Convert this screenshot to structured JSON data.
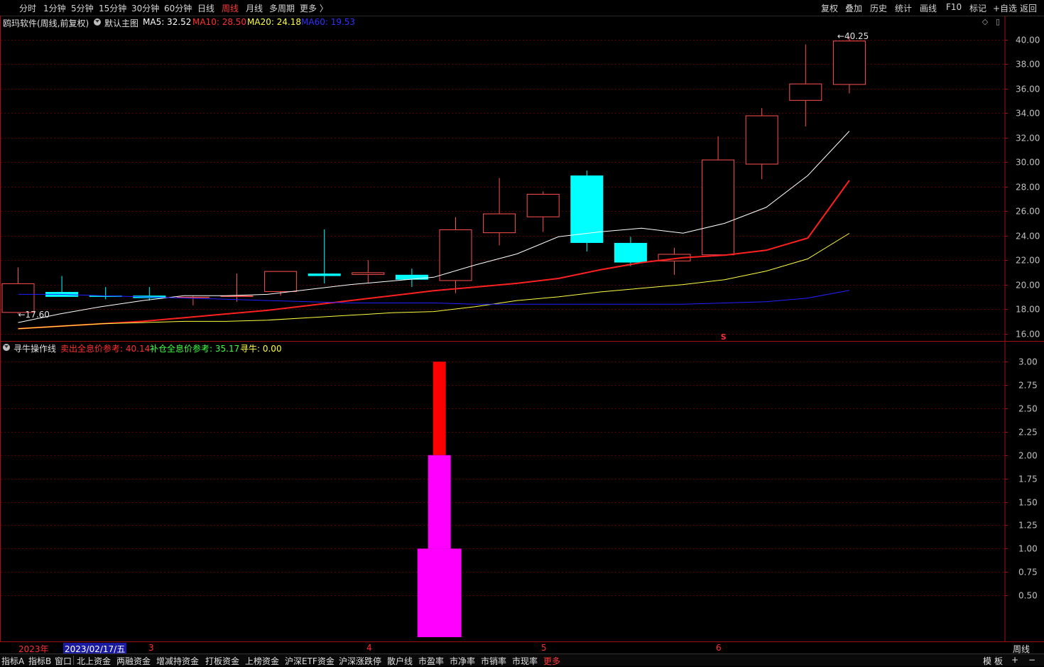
{
  "toolbar": {
    "left_items": [
      "分时",
      "1分钟",
      "5分钟",
      "15分钟",
      "30分钟",
      "60分钟",
      "日线",
      "周线",
      "月线",
      "多周期",
      "更多 〉"
    ],
    "active_item": "周线",
    "right_items": [
      "复权",
      "叠加",
      "历史",
      "统计",
      "画线",
      "F10",
      "标记",
      "+自选",
      "返回"
    ]
  },
  "main_info": {
    "stock_name": "鸥玛软件(周线,前复权)",
    "template": "默认主图",
    "ma5": "MA5: 32.52",
    "ma10": "MA10: 28.50",
    "ma20": "MA20: 24.18",
    "ma60": "MA60: 19.53"
  },
  "sub_info": {
    "indicator": "寻牛操作线",
    "sell_ref": "卖出全息价参考: 40.14",
    "add_ref": "补仓全息价参考: 35.17",
    "xunniu": "寻牛: 0.00"
  },
  "colors": {
    "up": "#ff5050",
    "down": "#00ffff",
    "ma5": "#ffffff",
    "ma10": "#ff2020",
    "ma20": "#ffff40",
    "ma60": "#2020ff",
    "grid": "#5a0000",
    "axis": "#a01010",
    "sell_bar": "#ff0000",
    "add_bar": "#ff00ff",
    "add_label": "#40ff40"
  },
  "chart_data": [
    {
      "type": "candlestick",
      "title": "鸥玛软件(周线,前复权)",
      "ylim": [
        15.4,
        40.9
      ],
      "yticks": [
        "16.00",
        "18.00",
        "20.00",
        "22.00",
        "24.00",
        "26.00",
        "28.00",
        "30.00",
        "32.00",
        "34.00",
        "36.00",
        "38.00",
        "40.00"
      ],
      "candles": [
        {
          "open": 17.7,
          "high": 21.4,
          "low": 17.6,
          "close": 20.1
        },
        {
          "open": 19.4,
          "high": 20.7,
          "low": 19.0,
          "close": 19.0
        },
        {
          "open": 19.1,
          "high": 19.8,
          "low": 18.8,
          "close": 19.0
        },
        {
          "open": 19.1,
          "high": 19.8,
          "low": 18.7,
          "close": 18.9
        },
        {
          "open": 19.0,
          "high": 19.1,
          "low": 18.3,
          "close": 19.0
        },
        {
          "open": 19.0,
          "high": 20.9,
          "low": 18.6,
          "close": 19.1
        },
        {
          "open": 19.4,
          "high": 21.1,
          "low": 19.1,
          "close": 21.1
        },
        {
          "open": 20.9,
          "high": 24.5,
          "low": 20.1,
          "close": 20.7
        },
        {
          "open": 20.8,
          "high": 22.0,
          "low": 20.1,
          "close": 21.0
        },
        {
          "open": 20.8,
          "high": 21.3,
          "low": 19.8,
          "close": 20.4
        },
        {
          "open": 20.3,
          "high": 25.5,
          "low": 19.3,
          "close": 24.5
        },
        {
          "open": 24.2,
          "high": 28.7,
          "low": 23.2,
          "close": 25.8
        },
        {
          "open": 25.5,
          "high": 27.6,
          "low": 24.3,
          "close": 27.4
        },
        {
          "open": 28.9,
          "high": 29.3,
          "low": 22.7,
          "close": 23.4
        },
        {
          "open": 23.4,
          "high": 23.9,
          "low": 21.5,
          "close": 21.8
        },
        {
          "open": 21.9,
          "high": 23.0,
          "low": 20.8,
          "close": 22.5
        },
        {
          "open": 22.4,
          "high": 32.1,
          "low": 22.4,
          "close": 30.2
        },
        {
          "open": 29.8,
          "high": 34.4,
          "low": 28.6,
          "close": 33.8
        },
        {
          "open": 35.0,
          "high": 39.6,
          "low": 32.9,
          "close": 36.4
        },
        {
          "open": 36.3,
          "high": 40.25,
          "low": 35.6,
          "close": 39.9
        }
      ],
      "series": [
        {
          "name": "MA5",
          "values": [
            16.9,
            17.6,
            18.2,
            18.7,
            19.1,
            19.1,
            19.2,
            19.6,
            20.0,
            20.3,
            20.6,
            21.6,
            22.5,
            23.9,
            24.3,
            24.6,
            24.2,
            25.0,
            26.3,
            28.9,
            32.52
          ]
        },
        {
          "name": "MA10",
          "values": [
            16.4,
            16.6,
            16.8,
            17.0,
            17.3,
            17.6,
            17.9,
            18.3,
            18.7,
            19.1,
            19.5,
            19.8,
            20.1,
            20.5,
            21.2,
            21.8,
            22.2,
            22.4,
            22.8,
            23.8,
            28.5
          ]
        },
        {
          "name": "MA20",
          "values": [
            16.4,
            16.6,
            16.8,
            16.9,
            17.0,
            17.0,
            17.1,
            17.3,
            17.5,
            17.7,
            17.8,
            18.2,
            18.7,
            19.0,
            19.4,
            19.7,
            20.0,
            20.4,
            21.1,
            22.1,
            24.18
          ]
        },
        {
          "name": "MA60",
          "values": [
            19.2,
            19.2,
            19.1,
            19.0,
            18.9,
            18.8,
            18.7,
            18.6,
            18.5,
            18.5,
            18.5,
            18.4,
            18.4,
            18.4,
            18.4,
            18.4,
            18.4,
            18.5,
            18.6,
            18.9,
            19.53
          ]
        }
      ],
      "annotations": {
        "max_label": "40.25",
        "min_label": "17.60",
        "marker": "S"
      }
    },
    {
      "type": "bar",
      "title": "寻牛操作线",
      "ylim": [
        0,
        3.1
      ],
      "yticks": [
        "0.50",
        "0.75",
        "1.00",
        "1.25",
        "1.50",
        "1.75",
        "2.00",
        "2.25",
        "2.50",
        "2.75",
        "3.00"
      ],
      "bars": [
        {
          "name": "卖出全息价参考",
          "from": 2,
          "to": 3,
          "color_key": "sell_bar",
          "width": "narrow"
        },
        {
          "name": "补仓全息价参考",
          "from": 1,
          "to": 2,
          "color_key": "add_bar",
          "width": "medium"
        },
        {
          "name": "寻牛",
          "from": 0,
          "to": 1,
          "color_key": "add_bar",
          "width": "wide"
        }
      ]
    }
  ],
  "date_axis": {
    "year_label": "2023年",
    "cursor_date": "2023/02/17/五",
    "month_labels": [
      "3",
      "4",
      "5",
      "6"
    ],
    "period_label": "周线"
  },
  "bottom_tabs": [
    "指标A",
    "指标B",
    "窗口",
    "北上资金",
    "两融资金",
    "增减持资金",
    "打板资金",
    "上榜资金",
    "沪深ETF资金",
    "沪深涨跌停",
    "散户线",
    "市盈率",
    "市净率",
    "市销率",
    "市现率",
    "更多"
  ],
  "bottom_right": [
    "模",
    "板",
    "+",
    "−"
  ]
}
